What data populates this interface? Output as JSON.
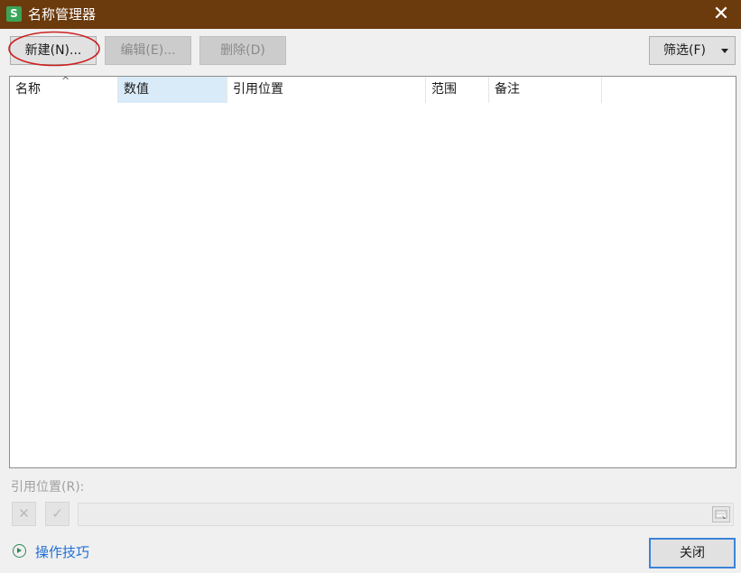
{
  "window": {
    "title": "名称管理器",
    "app_icon_letter": "S",
    "close_glyph": "✕"
  },
  "toolbar": {
    "new_label": "新建(N)...",
    "edit_label": "编辑(E)...",
    "delete_label": "删除(D)",
    "filter_label": "筛选(F)"
  },
  "table": {
    "columns": [
      "名称",
      "数值",
      "引用位置",
      "范围",
      "备注"
    ],
    "sort_indicator": "^",
    "rows": []
  },
  "reference": {
    "label": "引用位置(R):",
    "cancel_glyph": "✕",
    "confirm_glyph": "✓",
    "value": ""
  },
  "footer": {
    "tips_label": "操作技巧",
    "close_label": "关闭"
  },
  "colors": {
    "titlebar": "#6b3a0d",
    "selected_header": "#d9ebf9",
    "annotation_ellipse": "#cc2222",
    "tips_link": "#1e6fd6"
  }
}
